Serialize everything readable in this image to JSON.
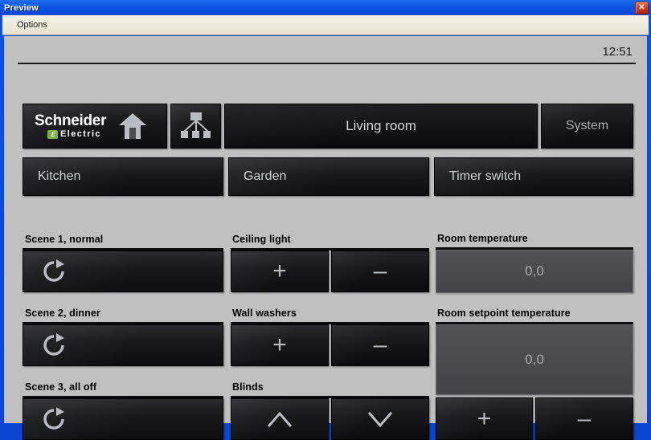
{
  "window": {
    "title": "Preview",
    "close_icon": "close-icon",
    "menu": [
      {
        "label": "Options"
      }
    ]
  },
  "statusbar": {
    "clock": "12:51"
  },
  "brand": {
    "line1": "Schneider",
    "line2": "Electric",
    "mark": "ℰ",
    "home_icon": "home-icon",
    "tree_icon": "hierarchy-tree-icon"
  },
  "topnav": {
    "room_title": "Living room",
    "system_label": "System"
  },
  "tabs": [
    {
      "label": "Kitchen"
    },
    {
      "label": "Garden"
    },
    {
      "label": "Timer switch"
    }
  ],
  "scenes": [
    {
      "label": "Scene 1, normal",
      "icon": "scene-recall-icon"
    },
    {
      "label": "Scene 2, dinner",
      "icon": "scene-recall-icon"
    },
    {
      "label": "Scene 3, all off",
      "icon": "scene-recall-icon"
    }
  ],
  "dimmers": [
    {
      "label": "Ceiling light",
      "up": "+",
      "down": "–"
    },
    {
      "label": "Wall washers",
      "up": "+",
      "down": "–"
    }
  ],
  "blinds": {
    "label": "Blinds",
    "up_icon": "chevron-up-icon",
    "down_icon": "chevron-down-icon"
  },
  "climate": {
    "room_temp_label": "Room temperature",
    "room_temp_value": "0,0",
    "setpoint_label": "Room setpoint temperature",
    "setpoint_value": "0,0",
    "setpoint_up": "+",
    "setpoint_down": "–"
  },
  "colors": {
    "window_border": "#0a46d2",
    "titlebar": "#0c55e2",
    "menubar": "#efebdb",
    "client_bg": "#c0c0c0",
    "panel_dark": "#141416",
    "panel_field": "#4a4a4e",
    "text_light": "#c9cbd0",
    "brand_green": "#7bb241",
    "close_red": "#d73d22"
  }
}
